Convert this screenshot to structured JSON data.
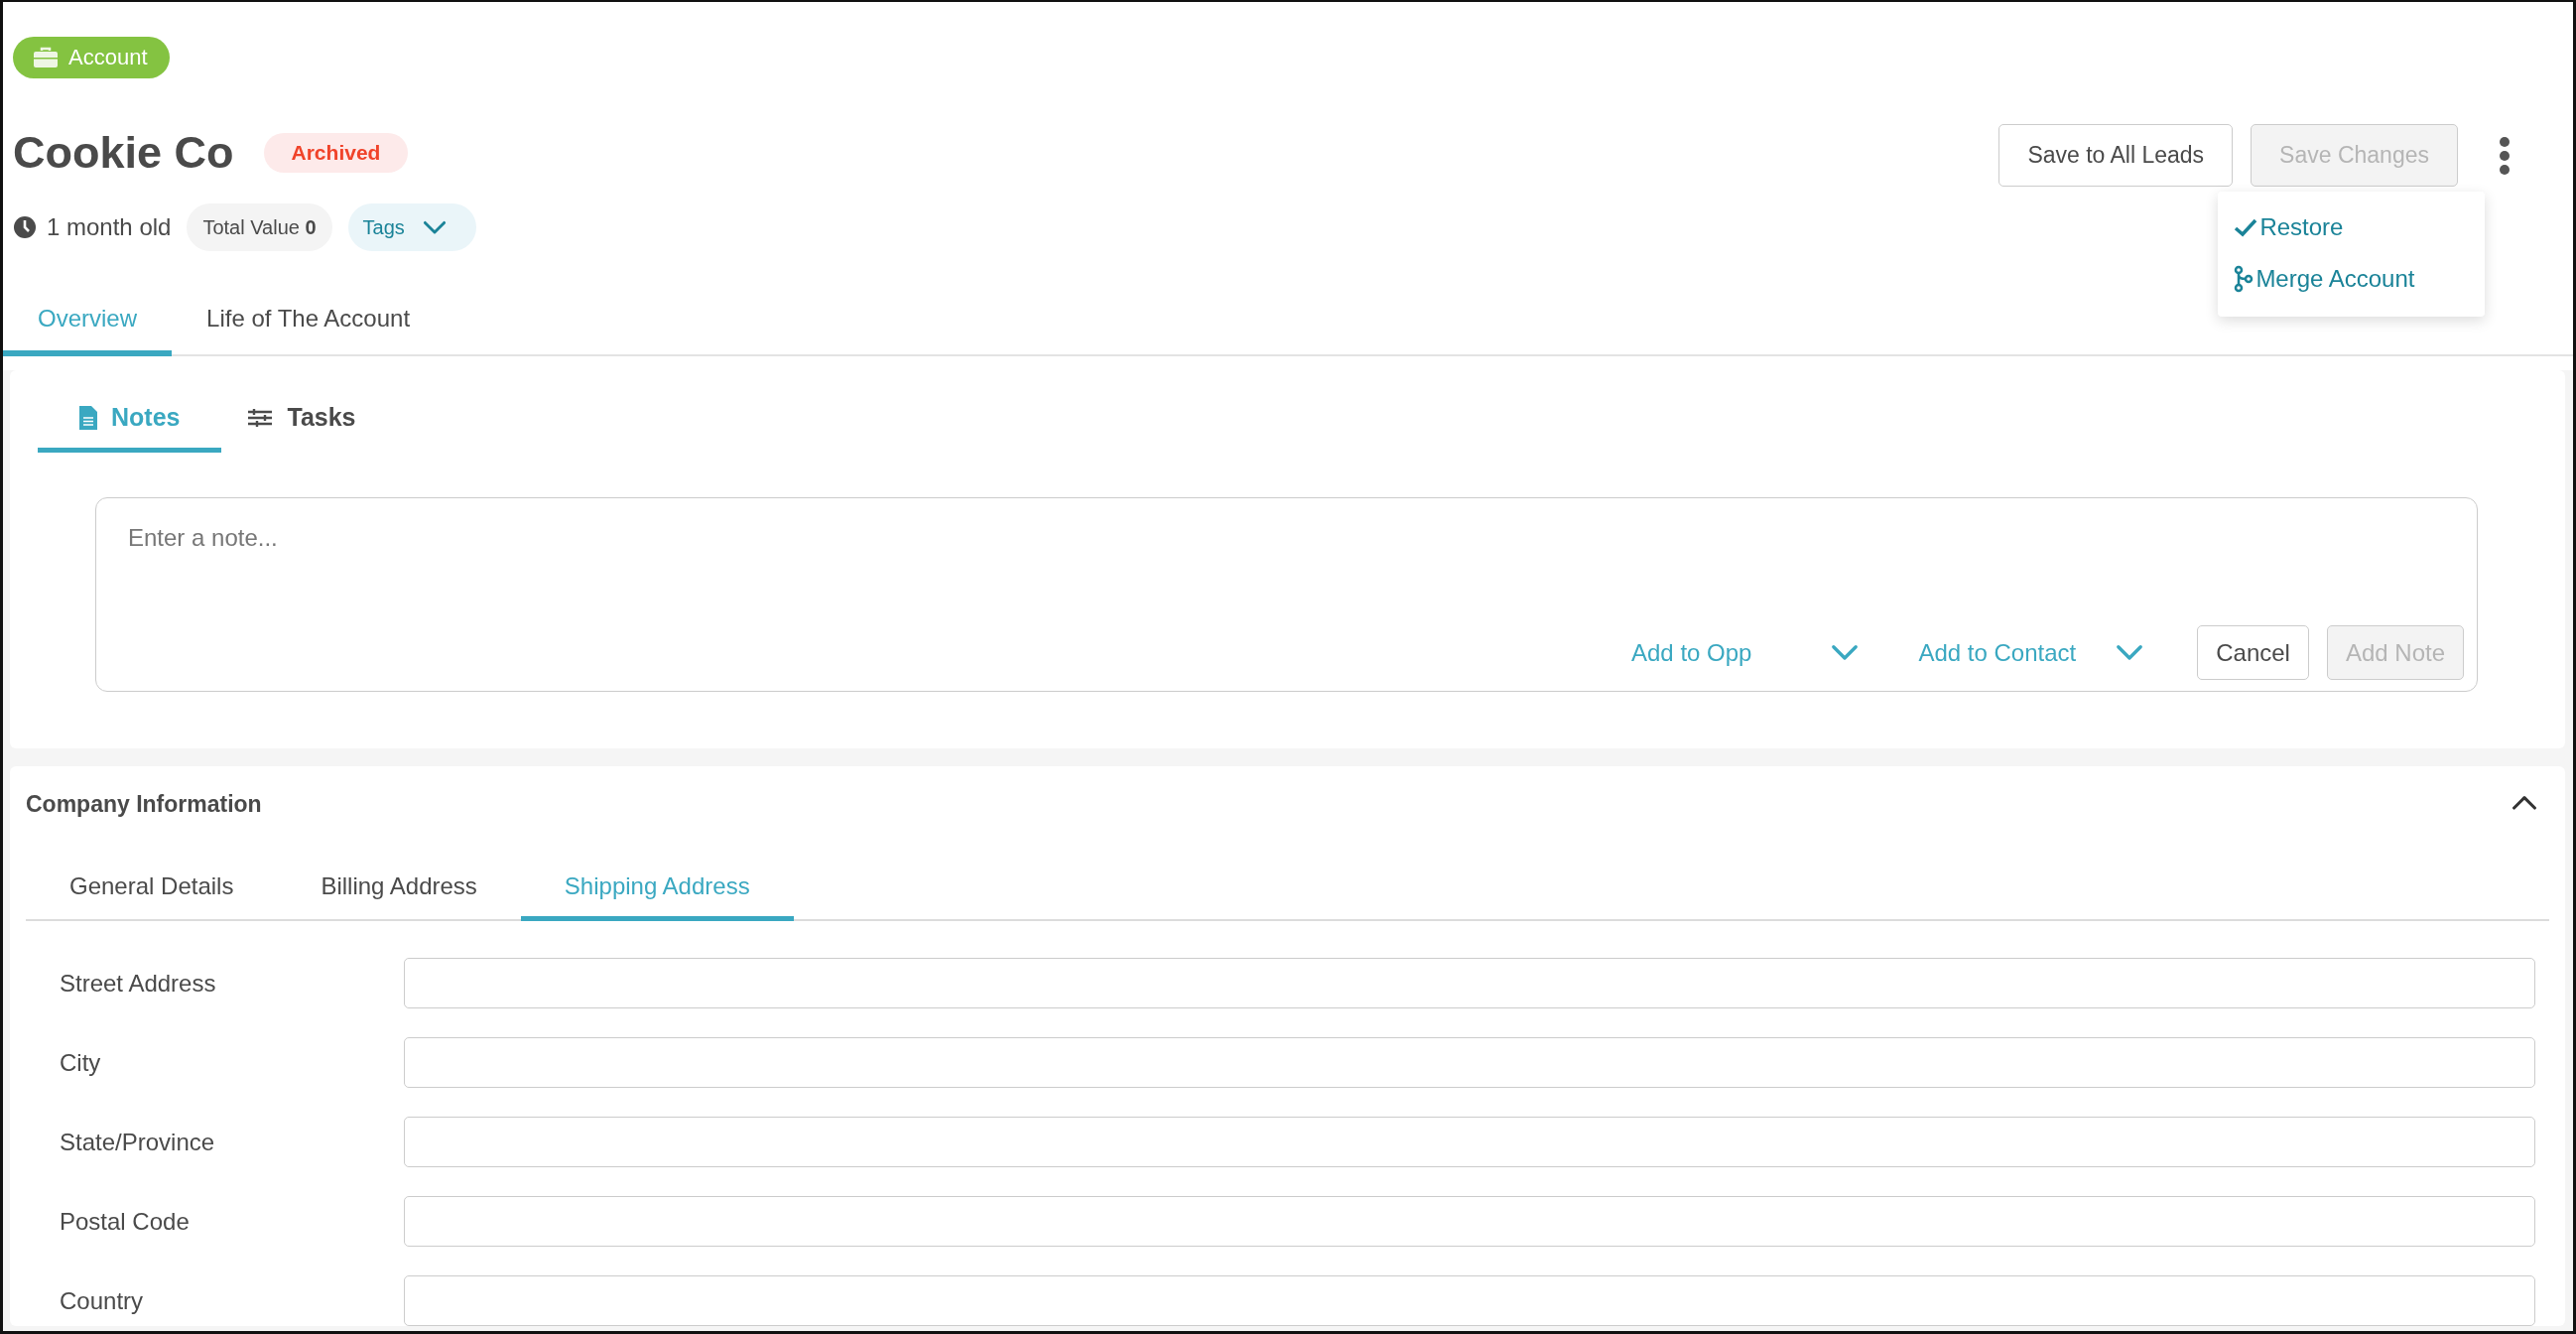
{
  "record_type_badge": {
    "label": "Account"
  },
  "title": "Cookie Co",
  "status_badge": "Archived",
  "meta": {
    "age": "1 month old",
    "total_value": "Total Value **0**",
    "tags_label": "Tags"
  },
  "actions": [
    {
      "label": "Save to All Leads",
      "disabled": false
    },
    {
      "label": "Save Changes",
      "disabled": true
    }
  ],
  "more_menu": {
    "open": true,
    "items": [
      {
        "label": "Restore",
        "kind": "check"
      },
      {
        "label": "Merge Account",
        "kind": "merge"
      }
    ]
  },
  "tabs": [
    {
      "label": "Overview",
      "selected": true
    },
    {
      "label": "Life of The Account",
      "selected": false
    }
  ],
  "notes_panel": {
    "tabs": [
      {
        "label": "Notes",
        "kind": "notes",
        "selected": true
      },
      {
        "label": "Tasks",
        "kind": "tasks",
        "selected": false
      }
    ],
    "placeholder": "Enter a note...",
    "dropdowns": [
      "Add to Opp",
      "Add to Contact"
    ],
    "buttons": [
      {
        "label": "Cancel",
        "disabled": false
      },
      {
        "label": "Add Note",
        "disabled": true
      }
    ]
  },
  "company_info": {
    "title": "Company Information",
    "expanded": true,
    "tabs": [
      {
        "label": "General Details",
        "selected": false
      },
      {
        "label": "Billing Address",
        "selected": false
      },
      {
        "label": "Shipping Address",
        "selected": true
      }
    ],
    "fields": [
      {
        "label": "Street Address"
      },
      {
        "label": "City"
      },
      {
        "label": "State/Province"
      },
      {
        "label": "Postal Code"
      },
      {
        "label": "Country"
      }
    ]
  }
}
